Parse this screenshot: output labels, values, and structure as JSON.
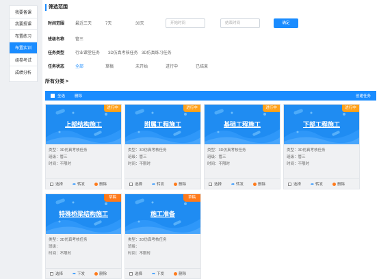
{
  "sidebar": {
    "items": [
      {
        "label": "我要备课",
        "active": false
      },
      {
        "label": "我要授课",
        "active": false
      },
      {
        "label": "布置练习",
        "active": false
      },
      {
        "label": "布置实训",
        "active": true
      },
      {
        "label": "组卷考试",
        "active": false
      },
      {
        "label": "成绩分析",
        "active": false
      }
    ]
  },
  "filter": {
    "heading": "筛选范围",
    "time": {
      "label": "时间范围",
      "options": [
        "最近三天",
        "7天",
        "30天"
      ],
      "start_placeholder": "开始时间",
      "end_placeholder": "结束时间",
      "confirm": "确定"
    },
    "class": {
      "label": "班级名称",
      "options": [
        "管三"
      ]
    },
    "type": {
      "label": "任务类型",
      "options": [
        "行业课堂任务",
        "3D仿真考核任务",
        "3D仿真练习任务"
      ]
    },
    "status": {
      "label": "任务状态",
      "options": [
        "全部",
        "草稿",
        "未开始",
        "进行中",
        "已结束"
      ],
      "selected": 0
    }
  },
  "classification": {
    "title": "所有分类 >"
  },
  "toolbar": {
    "select_all": "全选",
    "delete": "删除",
    "create": "创建任务"
  },
  "colors": {
    "accent": "#1a8cff",
    "badge_on": "#ffa11a",
    "badge_draft": "#ff7a1a",
    "banner": "#1f8cf2"
  },
  "cards": [
    {
      "title": "上部结构施工",
      "badge": "进行中",
      "badge_type": "on",
      "type_line": "类型：3D仿真考核任务",
      "class_line": "班级：管三",
      "time_line": "时间：不限时",
      "select": "选择",
      "share": "转发",
      "delete": "删除"
    },
    {
      "title": "附属工程施工",
      "badge": "进行中",
      "badge_type": "on",
      "type_line": "类型：3D仿真考核任务",
      "class_line": "班级：管三",
      "time_line": "时间：不限时",
      "select": "选择",
      "share": "转发",
      "delete": "删除"
    },
    {
      "title": "基础工程施工",
      "badge": "进行中",
      "badge_type": "on",
      "type_line": "类型：3D仿真考核任务",
      "class_line": "班级：管三",
      "time_line": "时间：不限时",
      "select": "选择",
      "share": "转发",
      "delete": "删除"
    },
    {
      "title": "下部工程施工",
      "badge": "进行中",
      "badge_type": "on",
      "type_line": "类型：3D仿真考核任务",
      "class_line": "班级：管三",
      "time_line": "时间：不限时",
      "select": "选择",
      "share": "转发",
      "delete": "删除"
    },
    {
      "title": "特殊桥梁结构施工",
      "badge": "草稿",
      "badge_type": "draft",
      "type_line": "类型：3D仿真考核任务",
      "class_line": "班级：",
      "time_line": "时间：不限时",
      "select": "选择",
      "share": "下发",
      "delete": "删除"
    },
    {
      "title": "施工准备",
      "badge": "草稿",
      "badge_type": "draft",
      "type_line": "类型：3D仿真考核任务",
      "class_line": "班级：",
      "time_line": "时间：不限时",
      "select": "选择",
      "share": "下发",
      "delete": "删除"
    }
  ]
}
